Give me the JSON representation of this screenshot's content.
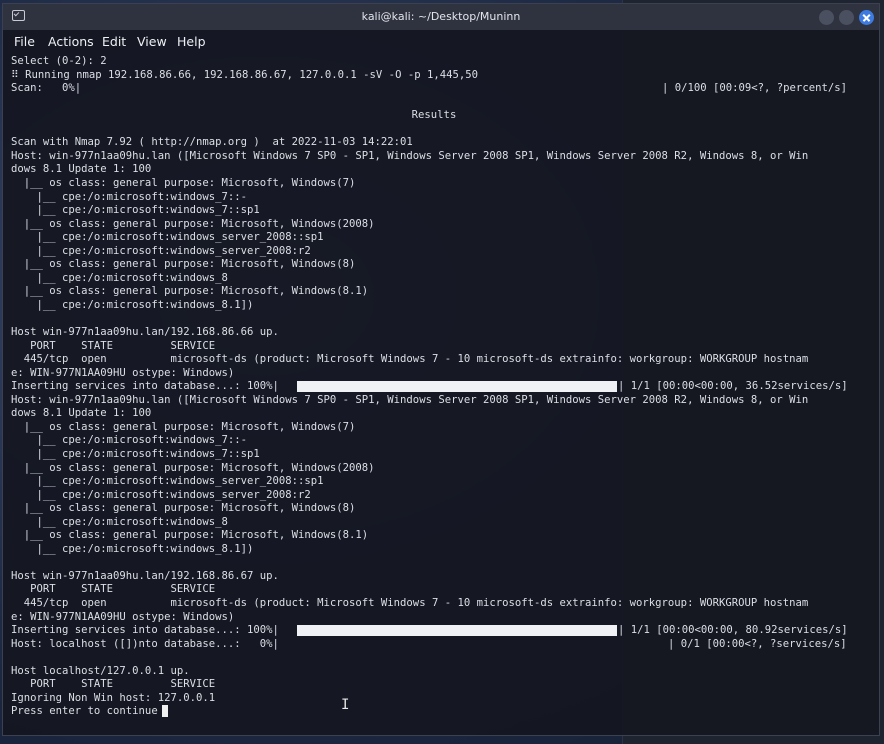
{
  "window": {
    "title": "kali@kali: ~/Desktop/Muninn",
    "icons": [
      "terminal-icon",
      "minimize-icon",
      "maximize-icon",
      "close-icon"
    ]
  },
  "menu": [
    "File",
    "Actions",
    "Edit",
    "View",
    "Help"
  ],
  "terminal": {
    "select_prompt": "Select (0-2): 2",
    "running": "Running nmap 192.168.86.66, 192.168.86.67, 127.0.0.1 -sV -O -p 1,445,50",
    "scan_left": "Scan:   0%|",
    "scan_right": "| 0/100 [00:09<?, ?percent/s]",
    "results_header": "Results",
    "block1": [
      "Scan with Nmap 7.92 ( http://nmap.org )  at 2022-11-03 14:22:01",
      "Host: win-977n1aa09hu.lan ([Microsoft Windows 7 SP0 - SP1, Windows Server 2008 SP1, Windows Server 2008 R2, Windows 8, or Win",
      "dows 8.1 Update 1: 100",
      "  |__ os class: general purpose: Microsoft, Windows(7)",
      "    |__ cpe:/o:microsoft:windows_7::-",
      "    |__ cpe:/o:microsoft:windows_7::sp1",
      "  |__ os class: general purpose: Microsoft, Windows(2008)",
      "    |__ cpe:/o:microsoft:windows_server_2008::sp1",
      "    |__ cpe:/o:microsoft:windows_server_2008:r2",
      "  |__ os class: general purpose: Microsoft, Windows(8)",
      "    |__ cpe:/o:microsoft:windows_8",
      "  |__ os class: general purpose: Microsoft, Windows(8.1)",
      "    |__ cpe:/o:microsoft:windows_8.1])",
      "",
      "Host win-977n1aa09hu.lan/192.168.86.66 up.",
      "   PORT    STATE         SERVICE",
      "  445/tcp  open          microsoft-ds (product: Microsoft Windows 7 - 10 microsoft-ds extrainfo: workgroup: WORKGROUP hostnam",
      "e: WIN-977N1AA09HU ostype: Windows)"
    ],
    "insert1_left": "Inserting services into database...: 100%|",
    "insert1_right": "| 1/1 [00:00<00:00, 36.52services/s]",
    "block2": [
      "Host: win-977n1aa09hu.lan ([Microsoft Windows 7 SP0 - SP1, Windows Server 2008 SP1, Windows Server 2008 R2, Windows 8, or Win",
      "dows 8.1 Update 1: 100",
      "  |__ os class: general purpose: Microsoft, Windows(7)",
      "    |__ cpe:/o:microsoft:windows_7::-",
      "    |__ cpe:/o:microsoft:windows_7::sp1",
      "  |__ os class: general purpose: Microsoft, Windows(2008)",
      "    |__ cpe:/o:microsoft:windows_server_2008::sp1",
      "    |__ cpe:/o:microsoft:windows_server_2008:r2",
      "  |__ os class: general purpose: Microsoft, Windows(8)",
      "    |__ cpe:/o:microsoft:windows_8",
      "  |__ os class: general purpose: Microsoft, Windows(8.1)",
      "    |__ cpe:/o:microsoft:windows_8.1])",
      "",
      "Host win-977n1aa09hu.lan/192.168.86.67 up.",
      "   PORT    STATE         SERVICE",
      "  445/tcp  open          microsoft-ds (product: Microsoft Windows 7 - 10 microsoft-ds extrainfo: workgroup: WORKGROUP hostnam",
      "e: WIN-977N1AA09HU ostype: Windows)"
    ],
    "insert2_left": "Inserting services into database...: 100%|",
    "insert2_right": "| 1/1 [00:00<00:00, 80.92services/s]",
    "localhost_left": "Host: localhost ([])nto database...:   0%|",
    "localhost_right": "| 0/1 [00:00<?, ?services/s]",
    "block3": [
      "",
      "Host localhost/127.0.0.1 up.",
      "   PORT    STATE         SERVICE",
      "Ignoring Non Win host: 127.0.0.1"
    ],
    "final_prompt": "Press enter to continue",
    "insert1_progress": 1.0,
    "insert2_progress": 1.0
  },
  "colors": {
    "terminal_bg": "#141720",
    "text": "#dcdfe5",
    "close_button": "#3d7be0"
  }
}
